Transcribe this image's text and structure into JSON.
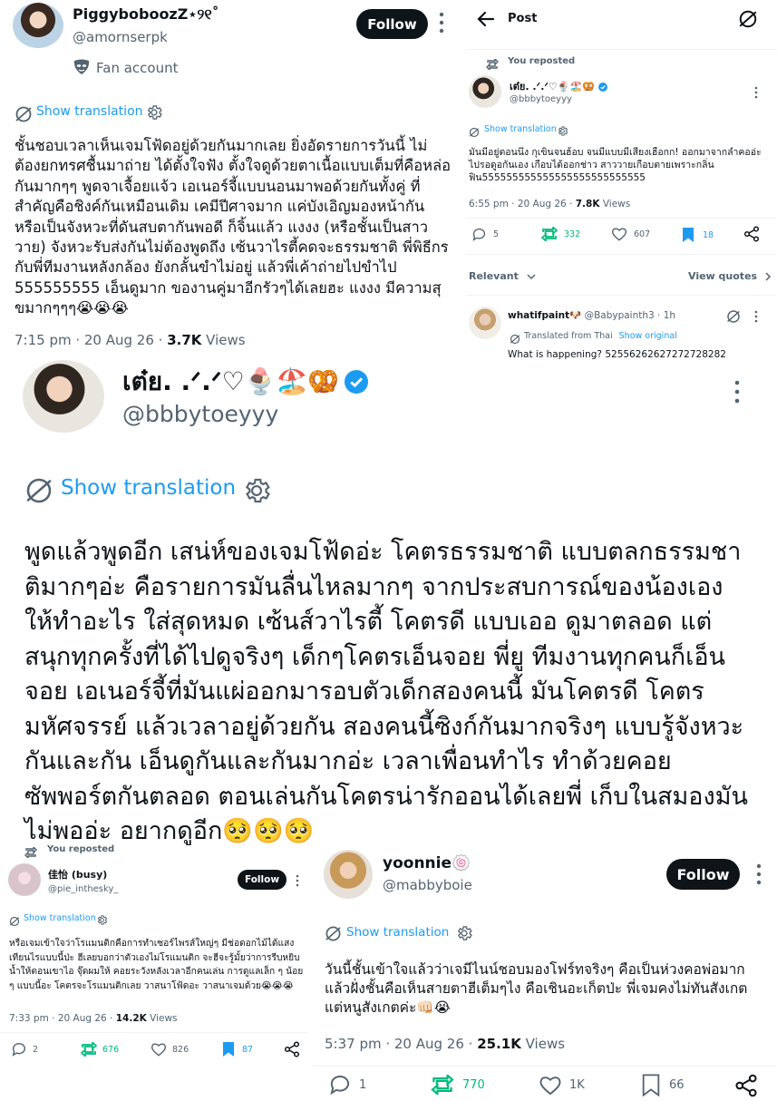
{
  "post1": {
    "name": "PiggyboboozZ⋆୨୧˚",
    "handle": "@amornserpk",
    "label": "Fan account",
    "follow": "Follow",
    "show_translation": "Show translation",
    "text": "ชั้นชอบเวลาเห็นเจมโฟ้ดอยู่ด้วยกันมากเลย ยิ่งอัดรายการวันนี้ ไม่ต้องยกทรศชื้นมาถ่าย ได้ตั้งใจฟัง ตั้งใจดูด้วยตาเนื้อแบบเต็มที่คือหล่อกันมากๆๆ พูดจาเจื้อยแจ้ว เอเนอร์จี้แบบนอนมาพอด้วยกันทั้งคู่ ที่สำคัญคือชิงค์กันเหมือนเดิม เคมีปีศาจมาก แค่บังเอิญมองหน้ากัน หรือเป็นจังหวะที่ดันสบตากันพอดี ก็จิ้นแล้ว แงงง (หรือชั้นเป็นสาววาย) จังหวะรับส่งกันไม่ต้องพูดถึง เซ้นวาไรตี้คดจะธรรมชาติ พี่พิธีกร กับพี่ทีมงานหลังกล้อง ยังกลั้นขำไม่อยู่ แล้วพี่เค้าถ่ายไปขำไป 555555555 เอ็นดูมาก ของานคู่มาอีกรัวๆได้เลยฮะ แงงง มีความสุขมากๆๆๆ😭😭😭",
    "time": "7:15 pm · 20 Aug 26 · ",
    "views_num": "3.7K",
    "views_label": " Views"
  },
  "post2": {
    "header_title": "Post",
    "reposted": "You reposted",
    "name": "เต๋ย. .ᐟ.ᐟ♡🍨🏖️🥨",
    "handle": "@bbbytoeyyy",
    "show_translation": "Show translation",
    "text": "มันมีอยู่ตอนนึง กุเขินจนฮ้อบ จนมีแบบมีเสียงเฮือกก! ออกมาจากลำคออ่ะ ไปรอดูอกันเอง เกือบได้ออกช่าว สาววายเกือบตายเพราะกลิ่นฟิน555555555555555555555555555",
    "time": "6:55 pm · 20 Aug 26 · ",
    "views_num": "7.8K",
    "views_label": " Views",
    "replies": "5",
    "reposts": "332",
    "likes": "607",
    "bookmarks": "18",
    "relevant": "Relevant",
    "view_quotes": "View quotes",
    "reply": {
      "name": "whatifpaint🐶",
      "handle": "@Babypainth3 · 1h",
      "translated": "Translated from Thai",
      "show_original": "Show original",
      "text": "What is happening? 52556262627272728282"
    }
  },
  "post3": {
    "name": "เต๋ย. .ᐟ.ᐟ♡🍨🏖️🥨",
    "handle": "@bbbytoeyyy",
    "show_translation": "Show translation",
    "text": "พูดแล้วพูดอีก เสน่ห์ของเจมโฟ้ดอ่ะ โคตรธรรมชาติ แบบตลกธรรมชาติมากๆอ่ะ คือรายการมันลื่นไหลมากๆ จากประสบการณ์ของน้องเอง ให้ทำอะไร ใส่สุดหมด เซ้นส์วาไรตี้ โคตรดี แบบเออ ดูมาตลอด แต่สนุกทุกครั้งที่ได้ไปดูจริงๆ เด็กๆโคตรเอ็นจอย พี่ยู ทีมงานทุกคนก็เอ็นจอย เอเนอร์จี้ที่มันแผ่ออกมารอบตัวเด็กสองคนนี้ มันโคตรดี โคตรมหัศจรรย์ แล้วเวลาอยู่ด้วยกัน สองคนนี้ซิงก์กันมากจริงๆ แบบรู้จังหวะกันและกัน เอ็นดูกันและกันมากอ่ะ เวลาเพื่อนทำไร ทำด้วยคอยซัพพอร์ตกันตลอด ตอนเล่นกันโคตรน่ารักออนได้เลยพี่ เก็บในสมองมันไม่พออ่ะ อยากดูอีก🥺🥺🥺"
  },
  "post4": {
    "reposted": "You reposted",
    "name": "佳怡 (busy)",
    "handle": "@pie_inthesky_",
    "follow": "Follow",
    "show_translation": "Show translation",
    "text": "หรือเจมเข้าใจว่าโรแมนติกคือการทำเซอร์ไพรส์ใหญ่ๆ มีช่อดอกไม้ได้แสงเทียนไรแบบนี้ป่ะ ฮีเลยบอกว่าตัวเองไม่โรแมนติก จะฮีจะรู้มั้ยว่าการรีบหยิบน้ำให้ตอนเขาไอ จุ๊ดผมให้ คอยระวังหลังเวลาอีกคนเล่น การดูแลเล็ก ๆ น้อย ๆ แบบนี้อะ โคตรจะโรแมนติกเลย วาสนาโฟ้ดอะ วาสนาเจมด้วย😭😭😭",
    "time": "7:33 pm · 20 Aug 26 · ",
    "views_num": "14.2K",
    "views_label": " Views",
    "replies": "2",
    "reposts": "676",
    "likes": "826",
    "bookmarks": "87"
  },
  "post5": {
    "name": "yoonnie🍥",
    "handle": "@mabbyboie",
    "follow": "Follow",
    "show_translation": "Show translation",
    "text": "วันนี้ชั้นเข้าใจแล้วว่าเจมีไนน์ชอบมองโฟร์ทจริงๆ คือเป็นห่วงคอพ่อมาก แล้วฝั่งชั้นคือเห็นสายตาฮีเต็มๆไง คือเชินอะเก็ตป่ะ พี่เจมคงไม่ทันสังเกตแต่หนูสังเกตค่ะ👊🏻😭",
    "time": "5:37 pm · 20 Aug 26 · ",
    "views_num": "25.1K",
    "views_label": " Views",
    "replies": "1",
    "reposts": "770",
    "likes": "1K",
    "bookmarks": "66"
  },
  "colors": {
    "link": "#1d9bf0",
    "verified": "#1d9bf0",
    "repost_green": "#00ba7c",
    "bookmark_blue": "#1d9bf0",
    "text": "#0f1419",
    "secondary": "#536471"
  }
}
